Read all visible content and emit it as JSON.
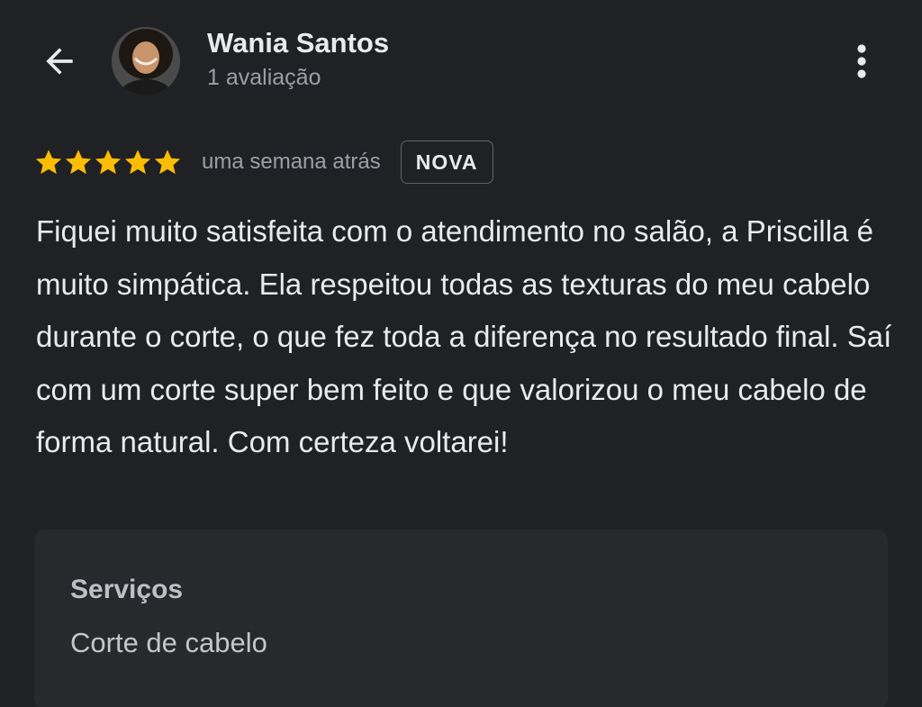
{
  "header": {
    "back_icon": "arrow-left-icon",
    "user_name": "Wania Santos",
    "review_count": "1 avaliação",
    "more_icon": "more-vert-icon"
  },
  "review": {
    "rating": 5,
    "rating_max": 5,
    "star_color": "#fbbc04",
    "time": "uma semana atrás",
    "badge": "NOVA",
    "text": "Fiquei muito satisfeita com o atendimento no salão, a Priscilla é muito simpática. Ela respeitou todas as texturas do meu cabelo durante o corte, o que fez toda a diferença no resultado final. Saí com um corte super bem feito e que valorizou o meu cabelo de forma natural. Com certeza voltarei!"
  },
  "services": {
    "title": "Serviços",
    "value": "Corte de cabelo"
  },
  "colors": {
    "background": "#202124",
    "card": "#28292c",
    "text_primary": "#e8eaed",
    "text_secondary": "#9aa0a6"
  }
}
